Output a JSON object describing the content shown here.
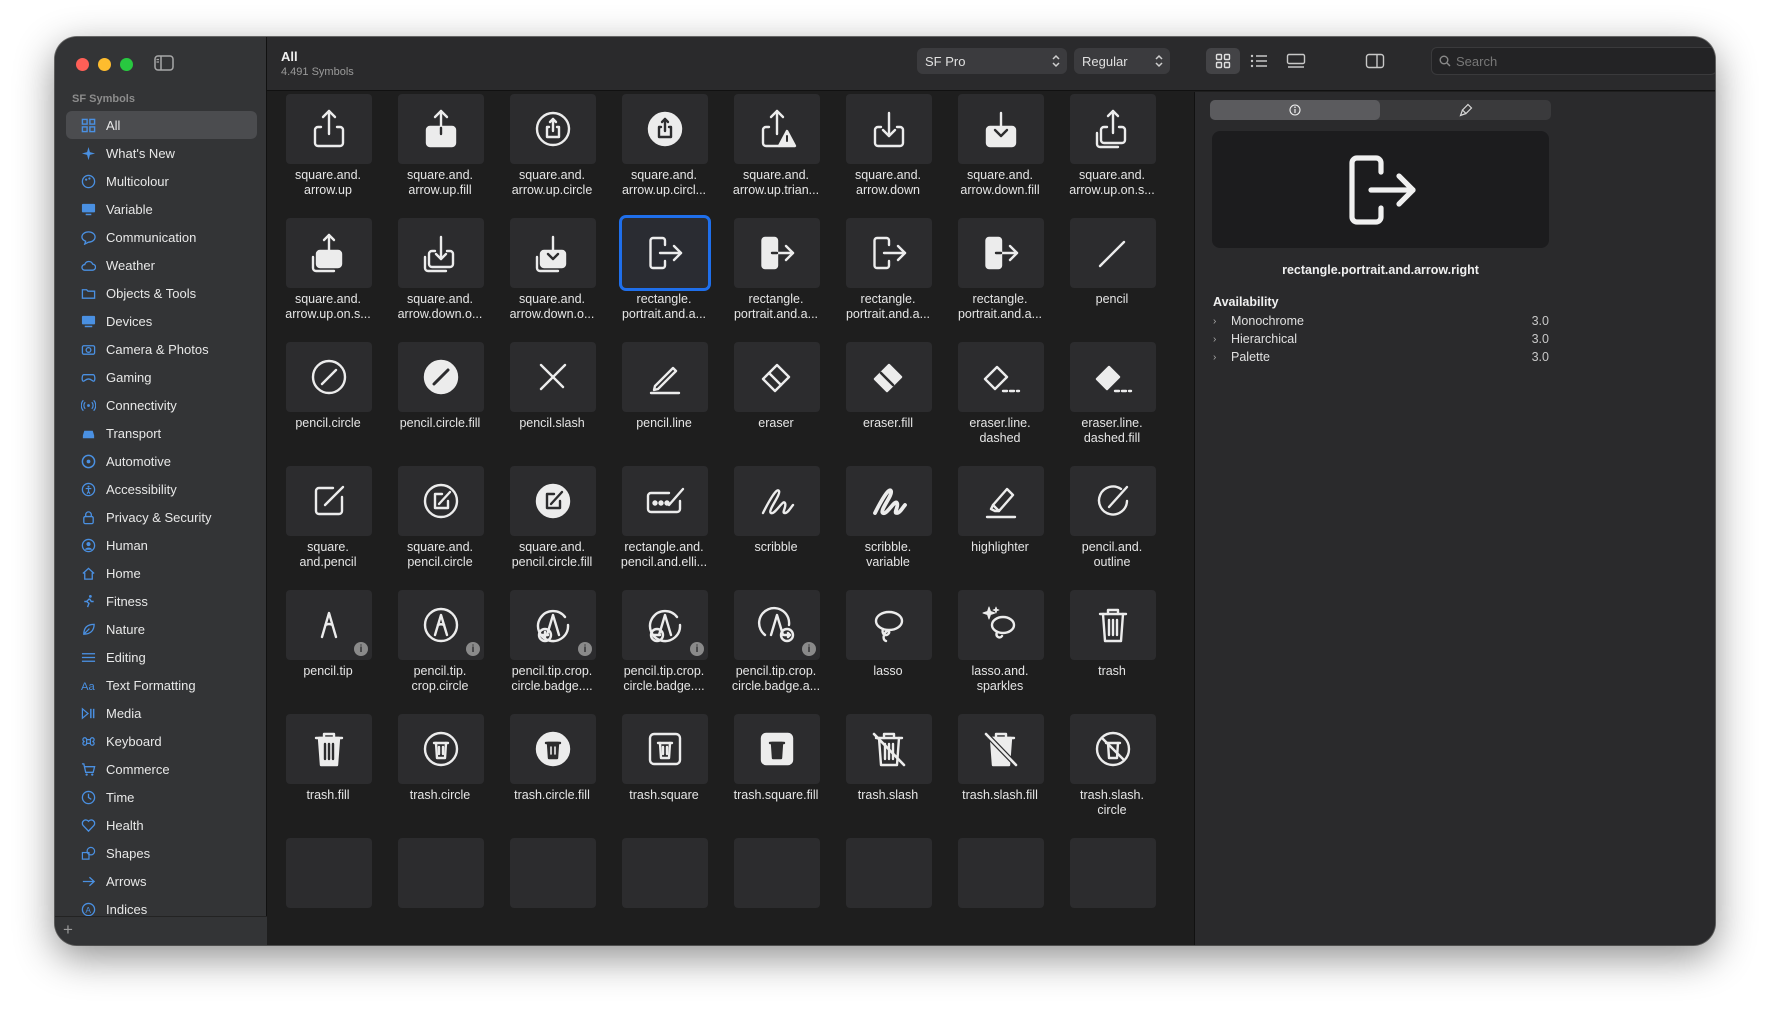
{
  "sidebar": {
    "section": "SF Symbols",
    "items": [
      {
        "label": "All",
        "icon": "grid-icon",
        "active": true
      },
      {
        "label": "What's New",
        "icon": "sparkle-icon"
      },
      {
        "label": "Multicolour",
        "icon": "palette-icon"
      },
      {
        "label": "Variable",
        "icon": "display-icon"
      },
      {
        "label": "Communication",
        "icon": "bubble-icon"
      },
      {
        "label": "Weather",
        "icon": "cloud-icon"
      },
      {
        "label": "Objects & Tools",
        "icon": "folder-icon"
      },
      {
        "label": "Devices",
        "icon": "monitor-icon"
      },
      {
        "label": "Camera & Photos",
        "icon": "camera-icon"
      },
      {
        "label": "Gaming",
        "icon": "gamecontroller-icon"
      },
      {
        "label": "Connectivity",
        "icon": "antenna-icon"
      },
      {
        "label": "Transport",
        "icon": "car-icon"
      },
      {
        "label": "Automotive",
        "icon": "steering-wheel-icon"
      },
      {
        "label": "Accessibility",
        "icon": "accessibility-icon"
      },
      {
        "label": "Privacy & Security",
        "icon": "lock-icon"
      },
      {
        "label": "Human",
        "icon": "person-icon"
      },
      {
        "label": "Home",
        "icon": "house-icon"
      },
      {
        "label": "Fitness",
        "icon": "figure-run-icon"
      },
      {
        "label": "Nature",
        "icon": "leaf-icon"
      },
      {
        "label": "Editing",
        "icon": "sliders-icon"
      },
      {
        "label": "Text Formatting",
        "icon": "textformat-icon"
      },
      {
        "label": "Media",
        "icon": "playpause-icon"
      },
      {
        "label": "Keyboard",
        "icon": "command-icon"
      },
      {
        "label": "Commerce",
        "icon": "cart-icon"
      },
      {
        "label": "Time",
        "icon": "clock-icon"
      },
      {
        "label": "Health",
        "icon": "heart-icon"
      },
      {
        "label": "Shapes",
        "icon": "shapes-icon"
      },
      {
        "label": "Arrows",
        "icon": "arrow-right-icon"
      },
      {
        "label": "Indices",
        "icon": "a-circle-icon"
      }
    ]
  },
  "toolbar": {
    "title": "All",
    "count": "4.491 Symbols",
    "font_select": "SF Pro",
    "weight_select": "Regular",
    "search_placeholder": "Search"
  },
  "symbols": [
    {
      "l1": "square.and.",
      "l2": "arrow.up",
      "icon": "share-icon"
    },
    {
      "l1": "square.and.",
      "l2": "arrow.up.fill",
      "icon": "share-fill-icon"
    },
    {
      "l1": "square.and.",
      "l2": "arrow.up.circle",
      "icon": "share-circle-icon"
    },
    {
      "l1": "square.and.",
      "l2": "arrow.up.circl...",
      "icon": "share-circle-fill-icon"
    },
    {
      "l1": "square.and.",
      "l2": "arrow.up.trian...",
      "icon": "share-triangle-icon"
    },
    {
      "l1": "square.and.",
      "l2": "arrow.down",
      "icon": "download-icon"
    },
    {
      "l1": "square.and.",
      "l2": "arrow.down.fill",
      "icon": "download-fill-icon"
    },
    {
      "l1": "square.and.",
      "l2": "arrow.up.on.s...",
      "icon": "share-stack-icon"
    },
    {
      "l1": "square.and.",
      "l2": "arrow.up.on.s...",
      "icon": "share-stack-fill-icon"
    },
    {
      "l1": "square.and.",
      "l2": "arrow.down.o...",
      "icon": "download-stack-icon"
    },
    {
      "l1": "square.and.",
      "l2": "arrow.down.o...",
      "icon": "download-stack-fill-icon"
    },
    {
      "l1": "rectangle.",
      "l2": "portrait.and.a...",
      "icon": "rect-arrow-right-icon",
      "selected": true
    },
    {
      "l1": "rectangle.",
      "l2": "portrait.and.a...",
      "icon": "rect-fill-arrow-right-icon"
    },
    {
      "l1": "rectangle.",
      "l2": "portrait.and.a...",
      "icon": "rect-arrow-right-icon"
    },
    {
      "l1": "rectangle.",
      "l2": "portrait.and.a...",
      "icon": "rect-fill-arrow-right-icon"
    },
    {
      "l1": "pencil",
      "l2": "",
      "icon": "pencil-icon"
    },
    {
      "l1": "pencil.circle",
      "l2": "",
      "icon": "pencil-circle-icon"
    },
    {
      "l1": "pencil.circle.fill",
      "l2": "",
      "icon": "pencil-circle-fill-icon"
    },
    {
      "l1": "pencil.slash",
      "l2": "",
      "icon": "pencil-slash-icon"
    },
    {
      "l1": "pencil.line",
      "l2": "",
      "icon": "pencil-line-icon"
    },
    {
      "l1": "eraser",
      "l2": "",
      "icon": "eraser-icon"
    },
    {
      "l1": "eraser.fill",
      "l2": "",
      "icon": "eraser-fill-icon"
    },
    {
      "l1": "eraser.line.",
      "l2": "dashed",
      "icon": "eraser-dashed-icon"
    },
    {
      "l1": "eraser.line.",
      "l2": "dashed.fill",
      "icon": "eraser-dashed-fill-icon"
    },
    {
      "l1": "square.",
      "l2": "and.pencil",
      "icon": "square-pencil-icon"
    },
    {
      "l1": "square.and.",
      "l2": "pencil.circle",
      "icon": "square-pencil-circle-icon"
    },
    {
      "l1": "square.and.",
      "l2": "pencil.circle.fill",
      "icon": "square-pencil-circle-fill-icon"
    },
    {
      "l1": "rectangle.and.",
      "l2": "pencil.and.elli...",
      "icon": "rect-pencil-ellipsis-icon"
    },
    {
      "l1": "scribble",
      "l2": "",
      "icon": "scribble-icon"
    },
    {
      "l1": "scribble.",
      "l2": "variable",
      "icon": "scribble-variable-icon"
    },
    {
      "l1": "highlighter",
      "l2": "",
      "icon": "highlighter-icon"
    },
    {
      "l1": "pencil.and.",
      "l2": "outline",
      "icon": "pencil-outline-icon"
    },
    {
      "l1": "pencil.tip",
      "l2": "",
      "icon": "pencil-tip-icon",
      "badge": true
    },
    {
      "l1": "pencil.tip.",
      "l2": "crop.circle",
      "icon": "pencil-tip-circle-icon",
      "badge": true
    },
    {
      "l1": "pencil.tip.crop.",
      "l2": "circle.badge....",
      "icon": "pencil-tip-plus-icon",
      "badge": true
    },
    {
      "l1": "pencil.tip.crop.",
      "l2": "circle.badge....",
      "icon": "pencil-tip-minus-icon",
      "badge": true
    },
    {
      "l1": "pencil.tip.crop.",
      "l2": "circle.badge.a...",
      "icon": "pencil-tip-arrow-icon",
      "badge": true
    },
    {
      "l1": "lasso",
      "l2": "",
      "icon": "lasso-icon"
    },
    {
      "l1": "lasso.and.",
      "l2": "sparkles",
      "icon": "lasso-sparkles-icon"
    },
    {
      "l1": "trash",
      "l2": "",
      "icon": "trash-icon"
    },
    {
      "l1": "trash.fill",
      "l2": "",
      "icon": "trash-fill-icon"
    },
    {
      "l1": "trash.circle",
      "l2": "",
      "icon": "trash-circle-icon"
    },
    {
      "l1": "trash.circle.fill",
      "l2": "",
      "icon": "trash-circle-fill-icon"
    },
    {
      "l1": "trash.square",
      "l2": "",
      "icon": "trash-square-icon"
    },
    {
      "l1": "trash.square.fill",
      "l2": "",
      "icon": "trash-square-fill-icon"
    },
    {
      "l1": "trash.slash",
      "l2": "",
      "icon": "trash-slash-icon"
    },
    {
      "l1": "trash.slash.fill",
      "l2": "",
      "icon": "trash-slash-fill-icon"
    },
    {
      "l1": "trash.slash.",
      "l2": "circle",
      "icon": "trash-slash-circle-icon"
    }
  ],
  "inspector": {
    "selected_name": "rectangle.portrait.and.arrow.right",
    "availability_title": "Availability",
    "availability": [
      {
        "label": "Monochrome",
        "version": "3.0"
      },
      {
        "label": "Hierarchical",
        "version": "3.0"
      },
      {
        "label": "Palette",
        "version": "3.0"
      }
    ]
  },
  "colors": {
    "accent": "#1f6feb",
    "sidebar_icon": "#4a90e2",
    "window_bg": "#1e1e1e"
  }
}
